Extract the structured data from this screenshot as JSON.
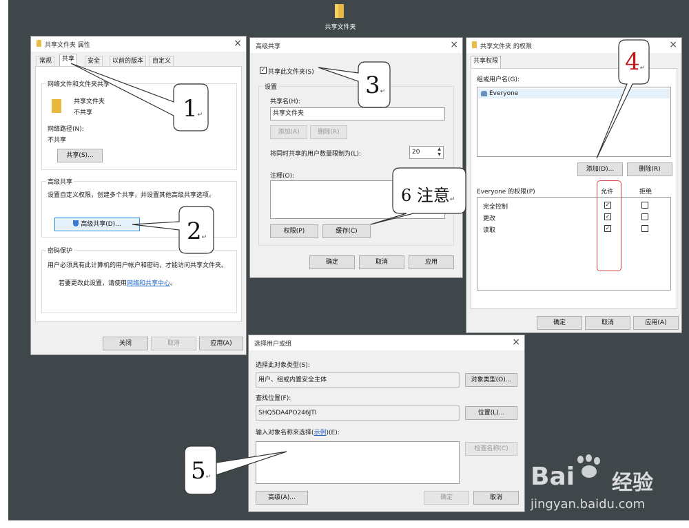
{
  "desktop": {
    "folder_label": "共享文件夹"
  },
  "props": {
    "title": "共享文件夹 属性",
    "tabs": [
      "常规",
      "共享",
      "安全",
      "以前的版本",
      "自定义"
    ],
    "section1_title": "网络文件和文件夹共享",
    "folder_name": "共享文件夹",
    "folder_status": "不共享",
    "path_label": "网络路径(N):",
    "path_value": "不共享",
    "share_btn": "共享(S)...",
    "adv_title": "高级共享",
    "adv_desc": "设置自定义权限，创建多个共享，并设置其他高级共享选项。",
    "adv_btn": "高级共享(D)...",
    "pwd_title": "密码保护",
    "pwd_desc": "用户必须具有此计算机的用户帐户和密码，才能访问共享文件夹。",
    "pwd_change_prefix": "若要更改此设置，请使用",
    "pwd_link": "网络和共享中心",
    "pwd_suffix": "。",
    "btn_close": "关闭",
    "btn_cancel": "取消",
    "btn_apply": "应用(A)"
  },
  "adv": {
    "title": "高级共享",
    "share_checkbox": "共享此文件夹(S)",
    "settings_title": "设置",
    "share_name_label": "共享名(H):",
    "share_name_value": "共享文件夹",
    "btn_add": "添加(A)",
    "btn_delete": "删除(R)",
    "limit_label": "将同时共享的用户数量限制为(L):",
    "limit_value": "20",
    "comment_label": "注释(O):",
    "btn_perm": "权限(P)",
    "btn_cache": "缓存(C)",
    "btn_ok": "确定",
    "btn_cancel": "取消",
    "btn_apply": "应用"
  },
  "perm": {
    "title": "共享文件夹 的权限",
    "tab": "共享权限",
    "group_label": "组或用户名(G):",
    "user": "Everyone",
    "btn_add": "添加(D)...",
    "btn_remove": "删除(R)",
    "perm_label": "Everyone 的权限(P)",
    "col_allow": "允许",
    "col_deny": "拒绝",
    "rows": [
      {
        "name": "完全控制",
        "allow": true,
        "deny": false
      },
      {
        "name": "更改",
        "allow": true,
        "deny": false
      },
      {
        "name": "读取",
        "allow": true,
        "deny": false
      }
    ],
    "btn_ok": "确定",
    "btn_cancel": "取消",
    "btn_apply": "应用(A)"
  },
  "select": {
    "title": "选择用户或组",
    "type_label": "选择此对象类型(S):",
    "type_value": "用户、组或内置安全主体",
    "btn_type": "对象类型(O)...",
    "loc_label": "查找位置(F):",
    "loc_value": "SHQ5DA4PO246JTI",
    "btn_loc": "位置(L)...",
    "input_label_prefix": "输入对象名称来选择(",
    "input_label_link": "示例",
    "input_label_suffix": ")(E):",
    "btn_check": "检查名称(C)",
    "btn_adv": "高级(A)...",
    "btn_ok": "确定",
    "btn_cancel": "取消"
  },
  "callouts": {
    "c1": "1",
    "c2": "2",
    "c3": "3",
    "c4": "4",
    "c5": "5",
    "c6": "6 注意",
    "ret": "↵"
  },
  "watermark": {
    "brand_latin": "Bai",
    "brand_cn": "经验",
    "url": "jingyan.baidu.com"
  }
}
